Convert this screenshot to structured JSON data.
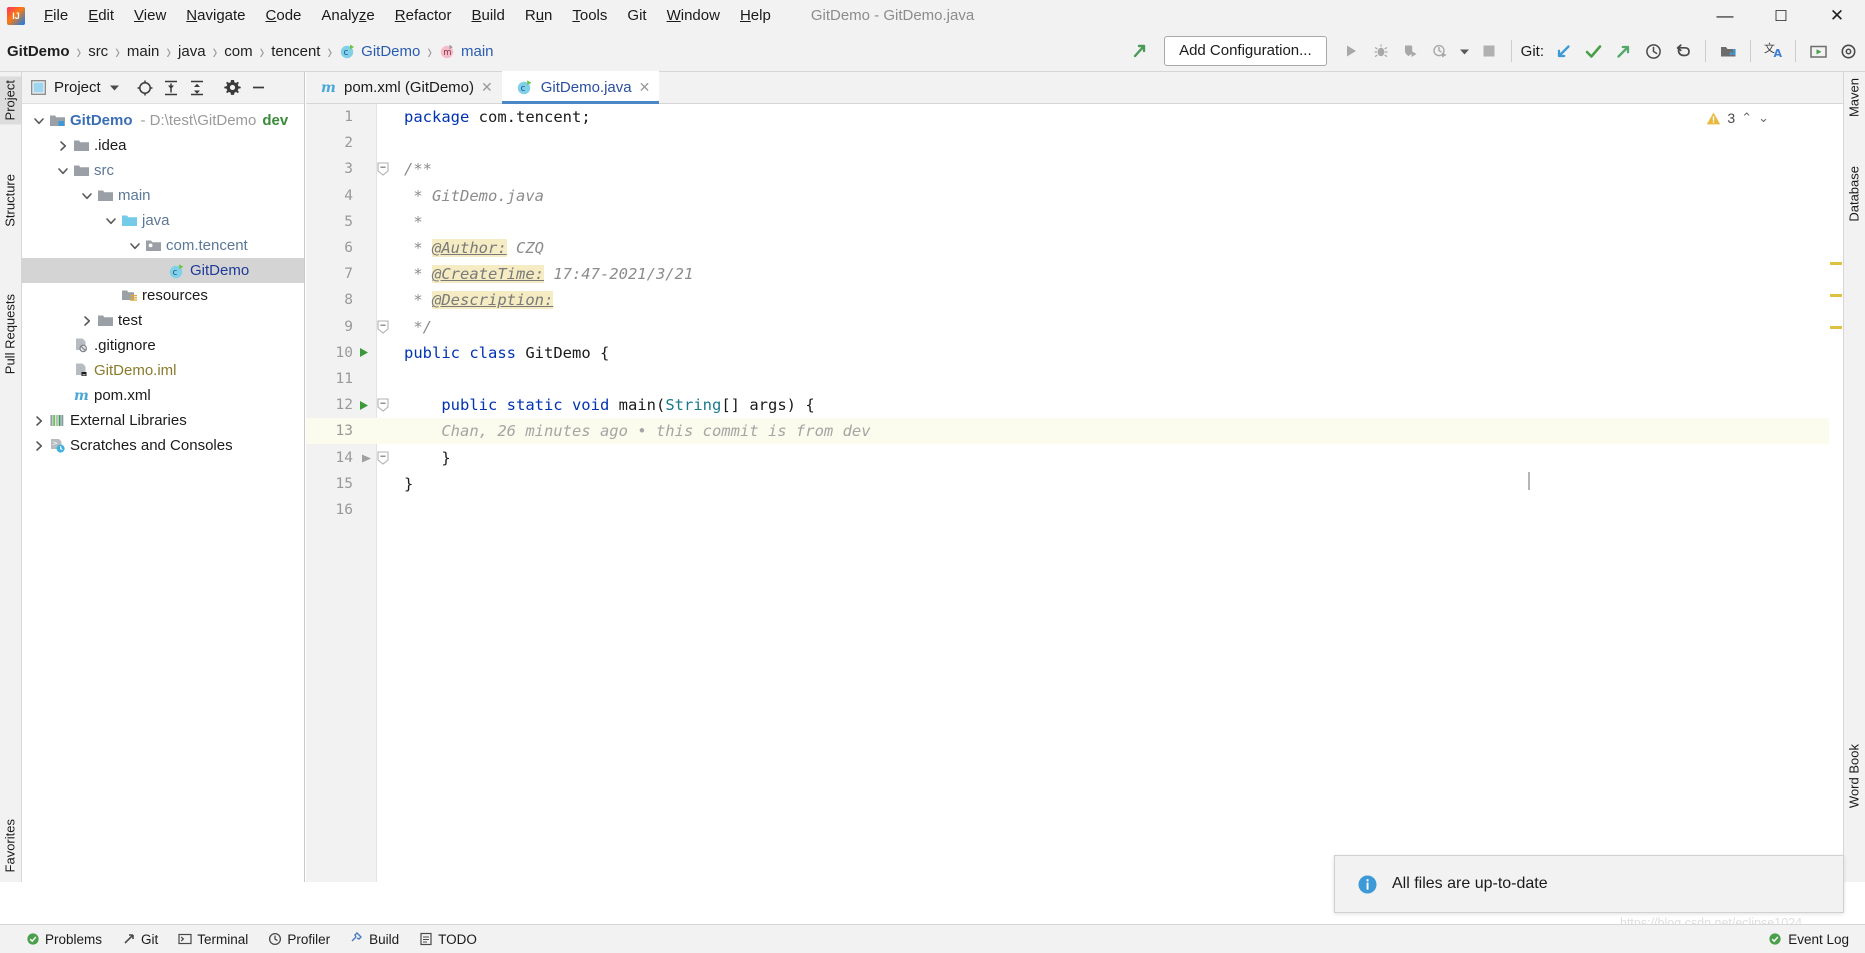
{
  "titlebar": {
    "logo_icon": "intellij-idea-logo-icon",
    "menus": [
      {
        "label": "File",
        "mnemonic": "F"
      },
      {
        "label": "Edit",
        "mnemonic": "E"
      },
      {
        "label": "View",
        "mnemonic": "V"
      },
      {
        "label": "Navigate",
        "mnemonic": "N"
      },
      {
        "label": "Code",
        "mnemonic": "C"
      },
      {
        "label": "Analyze",
        "mnemonic": "z"
      },
      {
        "label": "Refactor",
        "mnemonic": "R"
      },
      {
        "label": "Build",
        "mnemonic": "B"
      },
      {
        "label": "Run",
        "mnemonic": "u"
      },
      {
        "label": "Tools",
        "mnemonic": "T"
      },
      {
        "label": "Git",
        "mnemonic": ""
      },
      {
        "label": "Window",
        "mnemonic": "W"
      },
      {
        "label": "Help",
        "mnemonic": "H"
      }
    ],
    "window_title": "GitDemo - GitDemo.java",
    "controls": [
      {
        "name": "minimize-button",
        "glyph": "—"
      },
      {
        "name": "maximize-button",
        "glyph": "☐"
      },
      {
        "name": "close-button",
        "glyph": "✕"
      }
    ]
  },
  "navbar": {
    "breadcrumb": [
      {
        "label": "GitDemo",
        "style": "bold",
        "icon": ""
      },
      {
        "label": "src",
        "style": "",
        "icon": ""
      },
      {
        "label": "main",
        "style": "",
        "icon": ""
      },
      {
        "label": "java",
        "style": "",
        "icon": ""
      },
      {
        "label": "com",
        "style": "",
        "icon": ""
      },
      {
        "label": "tencent",
        "style": "",
        "icon": ""
      },
      {
        "label": "GitDemo",
        "style": "blue",
        "icon": "java-class-icon"
      },
      {
        "label": "main",
        "style": "blue",
        "icon": "java-method-icon"
      }
    ],
    "separator": "›",
    "run_config_label": "Add Configuration...",
    "git_label": "Git:",
    "toolbar_icons": [
      "updown-arrow-icon",
      "run-icon",
      "debug-icon",
      "run-coverage-icon",
      "profile-icon",
      "dropdown-arrow-icon",
      "stop-icon",
      "git-update-project-icon",
      "git-commit-icon",
      "git-push-icon",
      "git-history-icon",
      "git-rollback-icon",
      "search-everywhere-icon",
      "translate-icon",
      "presentation-icon",
      "settings-icon"
    ]
  },
  "left_tool_tabs": [
    {
      "label": "Project",
      "selected": true,
      "icon": "project-icon"
    },
    {
      "label": "Structure",
      "selected": false,
      "icon": "structure-icon"
    },
    {
      "label": "Pull Requests",
      "selected": false,
      "icon": "pull-requests-icon"
    },
    {
      "label": "Favorites",
      "selected": false,
      "icon": "favorites-icon"
    }
  ],
  "right_tool_tabs": [
    {
      "label": "Maven",
      "icon": "maven-icon"
    },
    {
      "label": "Database",
      "icon": "database-icon"
    },
    {
      "label": "Word Book",
      "icon": "word-book-icon"
    }
  ],
  "project_panel": {
    "title": "Project",
    "dropdown_glyph": "▾",
    "header_icons": [
      "locate-icon",
      "expand-all-icon",
      "collapse-all-icon",
      "gear-icon",
      "hide-icon"
    ],
    "tree": [
      {
        "indent": 0,
        "twisty": "∨",
        "icon": "project-module-icon",
        "label": "GitDemo",
        "style": "proj",
        "path": "- D:\\test\\GitDemo",
        "branch": "dev",
        "selected": false
      },
      {
        "indent": 1,
        "twisty": "›",
        "icon": "folder-icon",
        "label": ".idea",
        "style": "",
        "path": "",
        "branch": "",
        "selected": false
      },
      {
        "indent": 1,
        "twisty": "∨",
        "icon": "folder-icon",
        "label": "src",
        "style": "blue",
        "path": "",
        "branch": "",
        "selected": false
      },
      {
        "indent": 2,
        "twisty": "∨",
        "icon": "folder-icon",
        "label": "main",
        "style": "blue",
        "path": "",
        "branch": "",
        "selected": false
      },
      {
        "indent": 3,
        "twisty": "∨",
        "icon": "source-folder-icon",
        "label": "java",
        "style": "blue",
        "path": "",
        "branch": "",
        "selected": false
      },
      {
        "indent": 4,
        "twisty": "∨",
        "icon": "package-icon",
        "label": "com.tencent",
        "style": "blue",
        "path": "",
        "branch": "",
        "selected": false
      },
      {
        "indent": 5,
        "twisty": "",
        "icon": "java-class-icon",
        "label": "GitDemo",
        "style": "darkblue",
        "path": "",
        "branch": "",
        "selected": true
      },
      {
        "indent": 3,
        "twisty": "",
        "icon": "resources-folder-icon",
        "label": "resources",
        "style": "",
        "path": "",
        "branch": "",
        "selected": false
      },
      {
        "indent": 2,
        "twisty": "›",
        "icon": "folder-icon",
        "label": "test",
        "style": "",
        "path": "",
        "branch": "",
        "selected": false
      },
      {
        "indent": 1,
        "twisty": "",
        "icon": "gitignore-file-icon",
        "label": ".gitignore",
        "style": "",
        "path": "",
        "branch": "",
        "selected": false
      },
      {
        "indent": 1,
        "twisty": "",
        "icon": "iml-file-icon",
        "label": "GitDemo.iml",
        "style": "olive",
        "path": "",
        "branch": "",
        "selected": false
      },
      {
        "indent": 1,
        "twisty": "",
        "icon": "maven-pom-icon",
        "label": "pom.xml",
        "style": "",
        "path": "",
        "branch": "",
        "selected": false
      },
      {
        "indent": 0,
        "twisty": "›",
        "icon": "external-libraries-icon",
        "label": "External Libraries",
        "style": "",
        "path": "",
        "branch": "",
        "selected": false
      },
      {
        "indent": 0,
        "twisty": "›",
        "icon": "scratches-icon",
        "label": "Scratches and Consoles",
        "style": "",
        "path": "",
        "branch": "",
        "selected": false
      }
    ]
  },
  "editor": {
    "tabs": [
      {
        "label": "pom.xml (GitDemo)",
        "icon": "maven-pom-icon",
        "active": false,
        "close_glyph": "✕"
      },
      {
        "label": "GitDemo.java",
        "icon": "java-class-icon",
        "active": true,
        "close_glyph": "✕"
      }
    ],
    "inspection_count": "3",
    "inspection_icon": "warning-triangle-icon",
    "chevron_up": "⌃",
    "chevron_down": "⌄",
    "lines": [
      {
        "num": "1",
        "run": false,
        "fold": "",
        "blame": "",
        "html": "<span class=\"k\">package</span> <span class=\"t\">com.tencent;</span>"
      },
      {
        "num": "2",
        "run": false,
        "fold": "",
        "blame": "",
        "html": ""
      },
      {
        "num": "3",
        "run": false,
        "fold": "minus",
        "blame": "",
        "html": "<span class=\"cm\">/**</span>"
      },
      {
        "num": "4",
        "run": false,
        "fold": "",
        "blame": "",
        "html": "<span class=\"cm\"> * GitDemo.java</span>"
      },
      {
        "num": "5",
        "run": false,
        "fold": "",
        "blame": "",
        "html": "<span class=\"cm\"> *</span>"
      },
      {
        "num": "6",
        "run": false,
        "fold": "",
        "blame": "",
        "html": "<span class=\"cm\"> * </span><span class=\"doctag\">@Author:</span><span class=\"cm\"> CZQ</span>"
      },
      {
        "num": "7",
        "run": false,
        "fold": "",
        "blame": "",
        "html": "<span class=\"cm\"> * </span><span class=\"doctag\">@CreateTime:</span><span class=\"cm\"> 17:47-2021/3/21</span>"
      },
      {
        "num": "8",
        "run": false,
        "fold": "",
        "blame": "",
        "html": "<span class=\"cm\"> * </span><span class=\"doctag\">@Description:</span>"
      },
      {
        "num": "9",
        "run": false,
        "fold": "minus",
        "blame": "",
        "html": "<span class=\"cm\"> */</span>"
      },
      {
        "num": "10",
        "run": true,
        "fold": "",
        "blame": "",
        "html": "<span class=\"k\">public class</span> <span class=\"t\">GitDemo {</span>"
      },
      {
        "num": "11",
        "run": false,
        "fold": "",
        "blame": "",
        "html": ""
      },
      {
        "num": "12",
        "run": true,
        "fold": "minus",
        "blame": "",
        "html": "<span class=\"t\">    </span><span class=\"k\">public static void</span> <span class=\"t\">main(</span><span class=\"ty\">String</span><span class=\"t\">[] args) {</span>"
      },
      {
        "num": "13",
        "run": false,
        "fold": "",
        "blame": "Chan, 26 minutes ago • this commit is from dev",
        "html": ""
      },
      {
        "num": "14",
        "run": false,
        "fold": "minus",
        "blame": "",
        "html": "<span class=\"t\">    }</span>"
      },
      {
        "num": "15",
        "run": false,
        "fold": "",
        "blame": "",
        "html": "<span class=\"t\">}</span>"
      },
      {
        "num": "16",
        "run": false,
        "fold": "",
        "blame": "",
        "html": ""
      }
    ]
  },
  "notification": {
    "icon": "info-icon",
    "message": "All files are up-to-date"
  },
  "watermark": "https://blog.csdn.net/eclipse1024",
  "statusbar": {
    "items": [
      {
        "label": "Problems",
        "icon": "problems-icon"
      },
      {
        "label": "Git",
        "icon": "git-icon"
      },
      {
        "label": "Terminal",
        "icon": "terminal-icon"
      },
      {
        "label": "Profiler",
        "icon": "profiler-icon"
      },
      {
        "label": "Build",
        "icon": "build-icon"
      },
      {
        "label": "TODO",
        "icon": "todo-icon"
      }
    ],
    "right_label": "Event Log",
    "right_icon": "event-log-icon"
  },
  "colors": {
    "accent_blue": "#4a88c7",
    "keyword_blue": "#0033b3",
    "doctag_bg": "#f5ecc4",
    "blame_bg": "#fbfbee",
    "selection_gray": "#d4d4d4",
    "chrome_gray": "#f2f2f2",
    "branch_green": "#3a8a3a"
  }
}
